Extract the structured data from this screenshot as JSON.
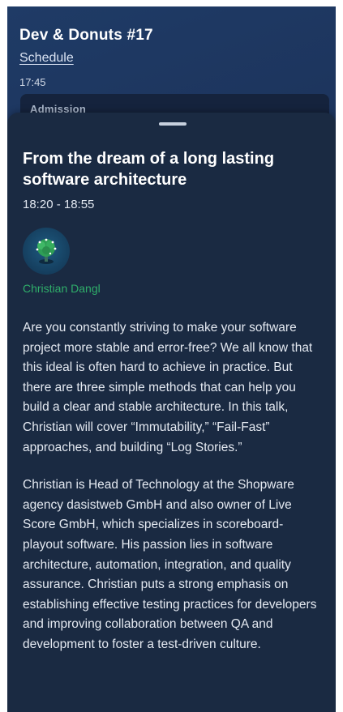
{
  "event": {
    "title": "Dev & Donuts #17",
    "schedule_link": "Schedule",
    "time": "17:45",
    "card_label": "Admission"
  },
  "talk": {
    "title": "From the dream of a long lasting software architecture",
    "time_range": "18:20 - 18:55",
    "speaker": {
      "name": "Christian Dangl",
      "avatar_icon": "tree-avatar-icon"
    },
    "description": [
      "Are you constantly striving to make your software project more stable and error-free? We all know that this ideal is often hard to achieve in practice. But there are three simple methods that can help you build a clear and stable architecture. In this talk, Christian will cover “Immutability,” “Fail-Fast” approaches, and building “Log Stories.”",
      "Christian is Head of Technology at the Shopware agency dasistweb GmbH and also owner of Live Score GmbH, which specializes in scoreboard-playout software. His passion lies in software architecture, automation, integration, and quality assurance. Christian puts a strong emphasis on establishing effective testing practices for developers and improving collaboration between QA and development to foster a test-driven culture."
    ]
  },
  "colors": {
    "background": "#1b3057",
    "sheet": "#1a2a42",
    "speaker_name": "#2fae6a",
    "text": "#e4e9f1"
  }
}
